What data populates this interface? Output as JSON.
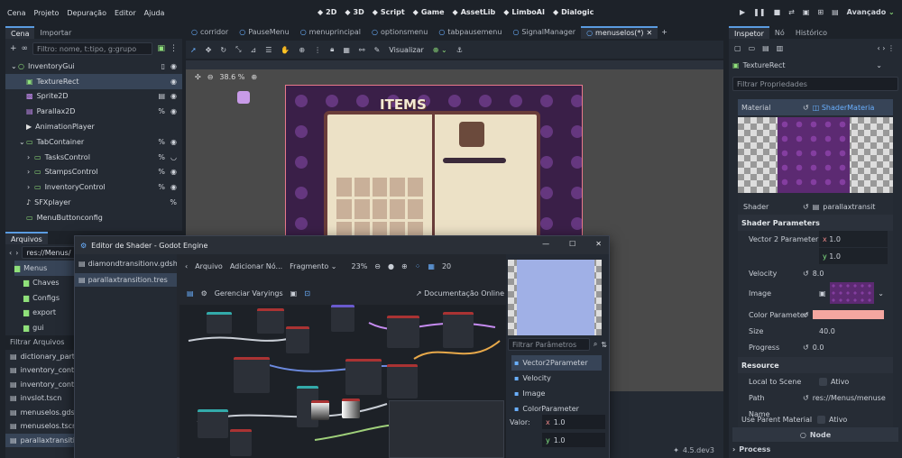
{
  "menu": [
    "Cena",
    "Projeto",
    "Depuração",
    "Editor",
    "Ajuda"
  ],
  "workspaces": [
    {
      "icon": "2d-icon",
      "label": "2D",
      "active": true
    },
    {
      "icon": "3d-icon",
      "label": "3D"
    },
    {
      "icon": "script-icon",
      "label": "Script"
    },
    {
      "icon": "game-icon",
      "label": "Game"
    },
    {
      "icon": "assetlib-icon",
      "label": "AssetLib"
    },
    {
      "icon": "limboai-icon",
      "label": "LimboAI"
    },
    {
      "icon": "dialogic-icon",
      "label": "Dialogic"
    }
  ],
  "renderer": "Avançado",
  "scene_panel": {
    "tabs": [
      "Cena",
      "Importar"
    ],
    "filter_placeholder": "Filtro: nome, t:tipo, g:grupo",
    "tree": [
      {
        "label": "InventoryGui",
        "indent": 0,
        "cls": "g",
        "glyph": "○",
        "right": [
          "▯",
          "◉"
        ]
      },
      {
        "label": "TextureRect",
        "indent": 1,
        "cls": "g",
        "glyph": "▣",
        "sel": true,
        "right": [
          "◉"
        ]
      },
      {
        "label": "Sprite2D",
        "indent": 1,
        "cls": "p",
        "glyph": "▩",
        "right": [
          "▤",
          "◉"
        ]
      },
      {
        "label": "Parallax2D",
        "indent": 1,
        "cls": "p",
        "glyph": "▤",
        "right": [
          "%",
          "◉"
        ]
      },
      {
        "label": "AnimationPlayer",
        "indent": 1,
        "cls": "w",
        "glyph": "▶",
        "right": []
      },
      {
        "label": "TabContainer",
        "indent": 1,
        "cls": "g",
        "glyph": "▭",
        "right": [
          "%",
          "◉"
        ],
        "arrow": "⌄"
      },
      {
        "label": "TasksControl",
        "indent": 2,
        "cls": "g",
        "glyph": "▭",
        "right": [
          "%",
          "◡"
        ],
        "arrow": "›"
      },
      {
        "label": "StampsControl",
        "indent": 2,
        "cls": "g",
        "glyph": "▭",
        "right": [
          "%",
          "◉"
        ],
        "arrow": "›"
      },
      {
        "label": "InventoryControl",
        "indent": 2,
        "cls": "g",
        "glyph": "▭",
        "right": [
          "%",
          "◉"
        ],
        "arrow": "›"
      },
      {
        "label": "SFXplayer",
        "indent": 1,
        "cls": "w",
        "glyph": "♪",
        "right": [
          "%"
        ]
      },
      {
        "label": "MenuButtonconfig",
        "indent": 1,
        "cls": "g",
        "glyph": "▭",
        "right": []
      }
    ]
  },
  "files_panel": {
    "tab": "Arquivos",
    "path": "res://Menus/",
    "folders": [
      {
        "label": "Menus",
        "sel": true
      },
      {
        "label": "Chaves"
      },
      {
        "label": "Configs"
      },
      {
        "label": "export"
      },
      {
        "label": "gui"
      }
    ],
    "filter": "Filtrar Arquivos",
    "files": [
      "dictionary_part.ts",
      "inventory_contro",
      "inventory_contro",
      "invslot.tscn",
      "menuselos.gdsha",
      "menuselos.tscn",
      "parallaxtransition"
    ]
  },
  "editor_tabs": [
    {
      "label": "corridor"
    },
    {
      "label": "PauseMenu"
    },
    {
      "label": "menuprincipal"
    },
    {
      "label": "optionsmenu"
    },
    {
      "label": "tabpausemenu"
    },
    {
      "label": "SignalManager"
    },
    {
      "label": "menuselos(*)",
      "active": true
    }
  ],
  "viewport": {
    "zoom": "38.6 %",
    "visualizar": "Visualizar",
    "items_title": "ITEMS"
  },
  "shader_window": {
    "title": "Editor de Shader - Godot Engine",
    "files": [
      {
        "label": "diamondtransitionv.gdshader"
      },
      {
        "label": "parallaxtransition.tres",
        "sel": true
      }
    ],
    "toolbar": {
      "arquivo": "Arquivo",
      "add_node": "Adicionar Nó...",
      "mode": "Fragmento",
      "zoom": "23%",
      "grid": "20",
      "varyings": "Gerenciar Varyings",
      "docs": "Documentação Online"
    },
    "param_filter": "Filtrar Parâmetros",
    "params": [
      {
        "label": "Vector2Parameter",
        "tag": "v2",
        "sel": true
      },
      {
        "label": "Velocity",
        "tag": "flt"
      },
      {
        "label": "Image",
        "tag": "img"
      },
      {
        "label": "ColorParameter",
        "tag": "col"
      }
    ],
    "value_label": "Valor:",
    "value_x": "1.0",
    "value_y": "1.0"
  },
  "inspector": {
    "tabs": [
      "Inspetor",
      "Nó",
      "Histórico"
    ],
    "node_name": "TextureRect",
    "filter": "Filtrar Propriedades",
    "material_label": "Material",
    "material_value": "ShaderMateria",
    "shader_label": "Shader",
    "shader_value": "parallaxtransit",
    "section_params": "Shader Parameters",
    "vec2_label": "Vector 2 Parameter",
    "vec2_x": "1.0",
    "vec2_y": "1.0",
    "velocity_label": "Velocity",
    "velocity_value": "8.0",
    "image_label": "Image",
    "color_label": "Color Parameter",
    "color_value": "#f4a6a0",
    "size_label": "Size",
    "size_value": "40.0",
    "progress_label": "Progress",
    "progress_value": "0.0",
    "section_resource": "Resource",
    "local_label": "Local to Scene",
    "local_value": "Ativo",
    "path_label": "Path",
    "path_value": "res://Menus/menuse",
    "name_label": "Name",
    "use_parent_label": "Use Parent Material",
    "use_parent_value": "Ativo",
    "node_section": "Node",
    "process_label": "Process"
  },
  "version": "4.5.dev3"
}
